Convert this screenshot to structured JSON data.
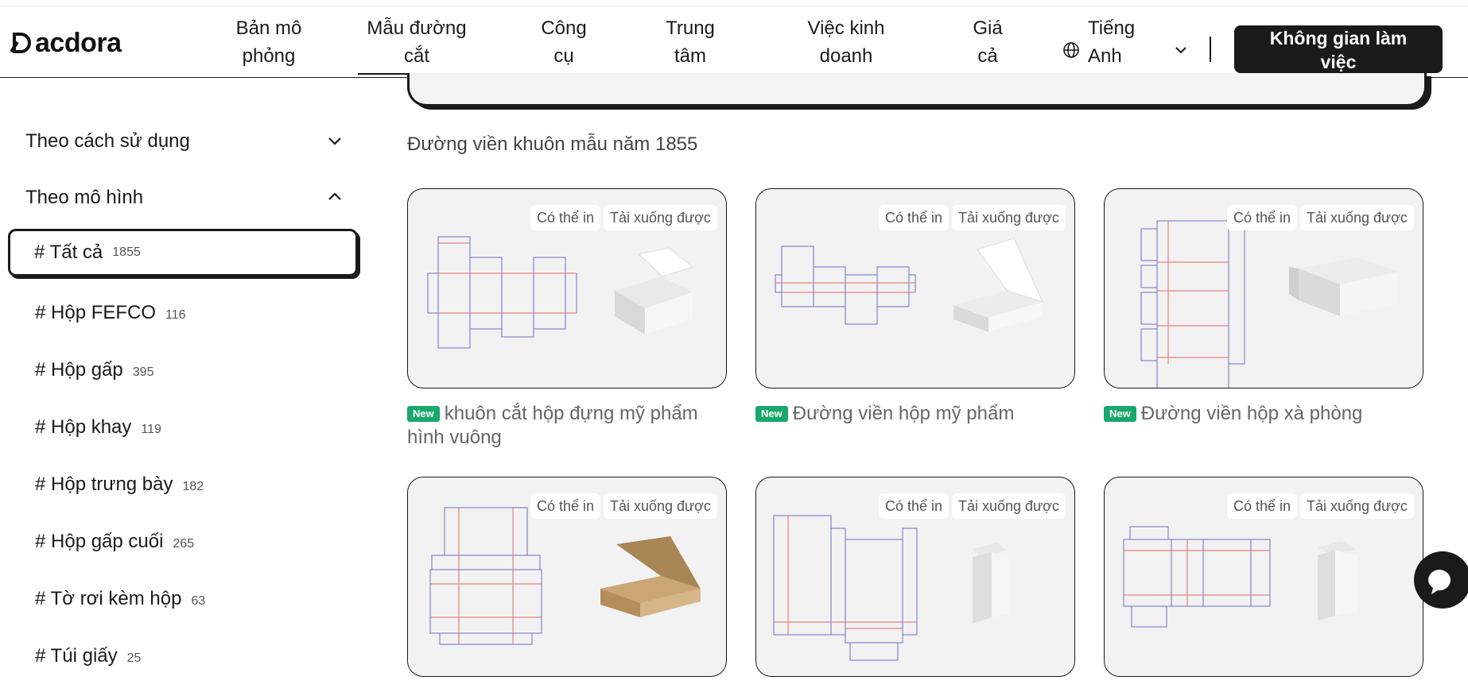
{
  "brand": {
    "name": "acdora"
  },
  "nav": {
    "items": [
      {
        "line1": "Bản mô",
        "line2": "phỏng"
      },
      {
        "line1": "Mẫu đường",
        "line2": "cắt"
      },
      {
        "line1": "Công",
        "line2": "cụ"
      },
      {
        "line1": "Trung",
        "line2": "tâm"
      },
      {
        "line1": "Việc kinh",
        "line2": "doanh"
      },
      {
        "line1": "Giá",
        "line2": "cả"
      }
    ],
    "language_line1": "Tiếng",
    "language_line2": "Anh",
    "cta_line1": "Không gian làm",
    "cta_line2": "việc"
  },
  "sidebar": {
    "groups": [
      {
        "label": "Theo cách sử dụng",
        "expanded": false
      },
      {
        "label": "Theo mô hình",
        "expanded": true
      }
    ],
    "items": [
      {
        "label": "# Tất cả",
        "count": "1855",
        "active": true
      },
      {
        "label": "# Hộp FEFCO",
        "count": "116"
      },
      {
        "label": "# Hộp gấp",
        "count": "395"
      },
      {
        "label": "# Hộp khay",
        "count": "119"
      },
      {
        "label": "# Hộp trưng bày",
        "count": "182"
      },
      {
        "label": "# Hộp gấp cuối",
        "count": "265"
      },
      {
        "label": "# Tờ rơi kèm hộp",
        "count": "63"
      },
      {
        "label": "# Túi giấy",
        "count": "25"
      }
    ]
  },
  "main": {
    "section_title": "Đường viền khuôn mẫu năm 1855",
    "badge_printable": "Có thể in",
    "badge_downloadable": "Tải xuống được",
    "new_label": "New",
    "cards": [
      {
        "title": "khuôn cắt hộp đựng mỹ phẩm hình vuông",
        "is_new": true,
        "box": "white-cube"
      },
      {
        "title": "Đường viền hộp mỹ phẩm",
        "is_new": true,
        "box": "white-tray"
      },
      {
        "title": "Đường viền hộp xà phòng",
        "is_new": true,
        "box": "white-long"
      },
      {
        "title": "",
        "is_new": false,
        "box": "kraft-mailer"
      },
      {
        "title": "",
        "is_new": false,
        "box": "white-tall"
      },
      {
        "title": "",
        "is_new": false,
        "box": "white-tall-2"
      }
    ]
  },
  "colors": {
    "accent": "#1a1a1a",
    "new_badge": "#18a86b",
    "dieline_cut": "#6f6fc8",
    "dieline_fold": "#e06a6a",
    "kraft": "#c9a673"
  }
}
